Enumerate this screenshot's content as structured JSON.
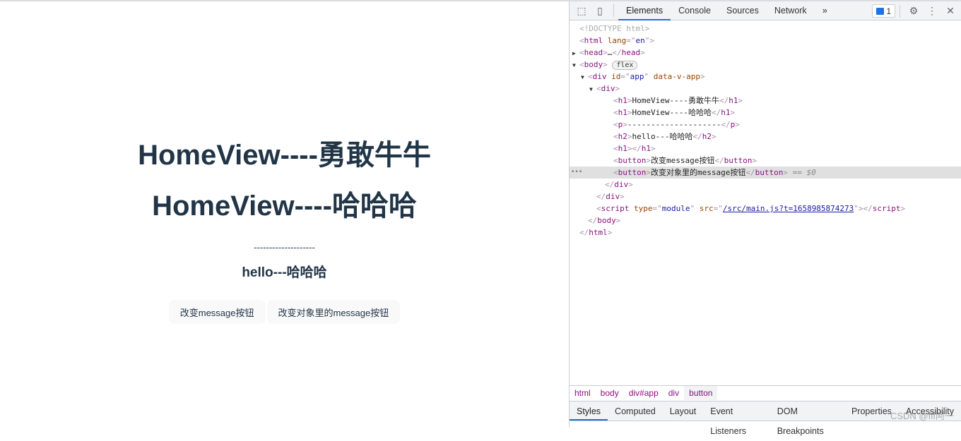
{
  "page": {
    "h1a": "HomeView----勇敢牛牛",
    "h1b": "HomeView----哈哈哈",
    "p": "--------------------",
    "h2": "hello---哈哈哈",
    "buttons": [
      "改变message按钮",
      "改变对象里的message按钮"
    ]
  },
  "devtools": {
    "tabs": [
      "Elements",
      "Console",
      "Sources",
      "Network"
    ],
    "more": "»",
    "issues_count": "1",
    "tree": [
      {
        "indent": 0,
        "tri": "",
        "segs": [
          [
            "cm",
            "<!DOCTYPE html>"
          ]
        ]
      },
      {
        "indent": 0,
        "tri": "",
        "segs": [
          [
            "br",
            "<"
          ],
          [
            "tg",
            "html "
          ],
          [
            "at",
            "lang"
          ],
          [
            "br",
            "=\""
          ],
          [
            "av",
            "en"
          ],
          [
            "br",
            "\">"
          ]
        ]
      },
      {
        "indent": 0,
        "tri": "▶",
        "segs": [
          [
            "br",
            "<"
          ],
          [
            "tg",
            "head"
          ],
          [
            "br",
            ">"
          ],
          [
            "tx",
            "…"
          ],
          [
            "br",
            "</"
          ],
          [
            "tg",
            "head"
          ],
          [
            "br",
            ">"
          ]
        ]
      },
      {
        "indent": 0,
        "tri": "▼",
        "segs": [
          [
            "br",
            "<"
          ],
          [
            "tg",
            "body"
          ],
          [
            "br",
            "> "
          ]
        ],
        "badge": "flex"
      },
      {
        "indent": 1,
        "tri": "▼",
        "segs": [
          [
            "br",
            "<"
          ],
          [
            "tg",
            "div "
          ],
          [
            "at",
            "id"
          ],
          [
            "br",
            "=\""
          ],
          [
            "av",
            "app"
          ],
          [
            "br",
            "\" "
          ],
          [
            "at",
            "data-v-app"
          ],
          [
            "br",
            ">"
          ]
        ]
      },
      {
        "indent": 2,
        "tri": "▼",
        "segs": [
          [
            "br",
            "<"
          ],
          [
            "tg",
            "div"
          ],
          [
            "br",
            ">"
          ]
        ]
      },
      {
        "indent": 4,
        "tri": "",
        "segs": [
          [
            "br",
            "<"
          ],
          [
            "tg",
            "h1"
          ],
          [
            "br",
            ">"
          ],
          [
            "tx",
            "HomeView----勇敢牛牛"
          ],
          [
            "br",
            "</"
          ],
          [
            "tg",
            "h1"
          ],
          [
            "br",
            ">"
          ]
        ]
      },
      {
        "indent": 4,
        "tri": "",
        "segs": [
          [
            "br",
            "<"
          ],
          [
            "tg",
            "h1"
          ],
          [
            "br",
            ">"
          ],
          [
            "tx",
            "HomeView----哈哈哈"
          ],
          [
            "br",
            "</"
          ],
          [
            "tg",
            "h1"
          ],
          [
            "br",
            ">"
          ]
        ]
      },
      {
        "indent": 4,
        "tri": "",
        "segs": [
          [
            "br",
            "<"
          ],
          [
            "tg",
            "p"
          ],
          [
            "br",
            ">"
          ],
          [
            "tx",
            "--------------------"
          ],
          [
            "br",
            "</"
          ],
          [
            "tg",
            "p"
          ],
          [
            "br",
            ">"
          ]
        ]
      },
      {
        "indent": 4,
        "tri": "",
        "segs": [
          [
            "br",
            "<"
          ],
          [
            "tg",
            "h2"
          ],
          [
            "br",
            ">"
          ],
          [
            "tx",
            "hello---哈哈哈"
          ],
          [
            "br",
            "</"
          ],
          [
            "tg",
            "h2"
          ],
          [
            "br",
            ">"
          ]
        ]
      },
      {
        "indent": 4,
        "tri": "",
        "segs": [
          [
            "br",
            "<"
          ],
          [
            "tg",
            "h1"
          ],
          [
            "br",
            "></"
          ],
          [
            "tg",
            "h1"
          ],
          [
            "br",
            ">"
          ]
        ]
      },
      {
        "indent": 4,
        "tri": "",
        "segs": [
          [
            "br",
            "<"
          ],
          [
            "tg",
            "button"
          ],
          [
            "br",
            ">"
          ],
          [
            "tx",
            "改变message按钮"
          ],
          [
            "br",
            "</"
          ],
          [
            "tg",
            "button"
          ],
          [
            "br",
            ">"
          ]
        ]
      },
      {
        "indent": 4,
        "tri": "",
        "sel": true,
        "segs": [
          [
            "br",
            "<"
          ],
          [
            "tg",
            "button"
          ],
          [
            "br",
            ">"
          ],
          [
            "tx",
            "改变对象里的message按钮"
          ],
          [
            "br",
            "</"
          ],
          [
            "tg",
            "button"
          ],
          [
            "br",
            "> "
          ],
          [
            "eq",
            "== $0"
          ]
        ]
      },
      {
        "indent": 3,
        "tri": "",
        "segs": [
          [
            "br",
            "</"
          ],
          [
            "tg",
            "div"
          ],
          [
            "br",
            ">"
          ]
        ]
      },
      {
        "indent": 2,
        "tri": "",
        "segs": [
          [
            "br",
            "</"
          ],
          [
            "tg",
            "div"
          ],
          [
            "br",
            ">"
          ]
        ]
      },
      {
        "indent": 2,
        "tri": "",
        "segs": [
          [
            "br",
            "<"
          ],
          [
            "tg",
            "script "
          ],
          [
            "at",
            "type"
          ],
          [
            "br",
            "=\""
          ],
          [
            "av",
            "module"
          ],
          [
            "br",
            "\" "
          ],
          [
            "at",
            "src"
          ],
          [
            "br",
            "=\""
          ],
          [
            "lk",
            "/src/main.js?t=1658985874273"
          ],
          [
            "br",
            "\"></"
          ],
          [
            "tg",
            "script"
          ],
          [
            "br",
            ">"
          ]
        ]
      },
      {
        "indent": 1,
        "tri": "",
        "segs": [
          [
            "br",
            "</"
          ],
          [
            "tg",
            "body"
          ],
          [
            "br",
            ">"
          ]
        ]
      },
      {
        "indent": 0,
        "tri": "",
        "segs": [
          [
            "br",
            "</"
          ],
          [
            "tg",
            "html"
          ],
          [
            "br",
            ">"
          ]
        ]
      }
    ],
    "breadcrumbs": [
      "html",
      "body",
      "div#app",
      "div",
      "button"
    ],
    "subtabs": [
      "Styles",
      "Computed",
      "Layout",
      "Event Listeners",
      "DOM Breakpoints",
      "Properties",
      "Accessibility"
    ],
    "watermark": "CSDN @fff阿一"
  }
}
